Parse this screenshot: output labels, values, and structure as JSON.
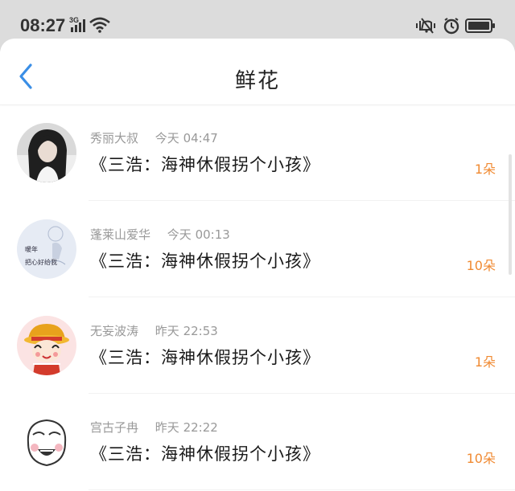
{
  "status_bar": {
    "time": "08:27",
    "network": "3G",
    "icons": [
      "signal-icon",
      "wifi-icon",
      "mute-icon",
      "alarm-icon",
      "battery-icon"
    ]
  },
  "header": {
    "title": "鲜花",
    "back_icon": "chevron-left-icon"
  },
  "colors": {
    "accent": "#3a8ee6",
    "count": "#f08a32",
    "meta": "#999999",
    "status_bar_bg": "#dcdcdc"
  },
  "items": [
    {
      "name": "秀丽大叔",
      "time": "今天 04:47",
      "post": "《三浩：海神休假拐个小孩》",
      "count": "1朵",
      "avatar": "girl-photo-avatar"
    },
    {
      "name": "蓬莱山爱华",
      "time": "今天 00:13",
      "post": "《三浩：海神休假拐个小孩》",
      "count": "10朵",
      "avatar": "sketch-avatar",
      "avatar_text": [
        "暖年",
        "把心好给我"
      ]
    },
    {
      "name": "无妄波涛",
      "time": "昨天 22:53",
      "post": "《三浩：海神休假拐个小孩》",
      "count": "1朵",
      "avatar": "cartoon-girl-avatar"
    },
    {
      "name": "宫古子冉",
      "time": "昨天 22:22",
      "post": "《三浩：海神休假拐个小孩》",
      "count": "10朵",
      "avatar": "meme-face-avatar"
    }
  ]
}
